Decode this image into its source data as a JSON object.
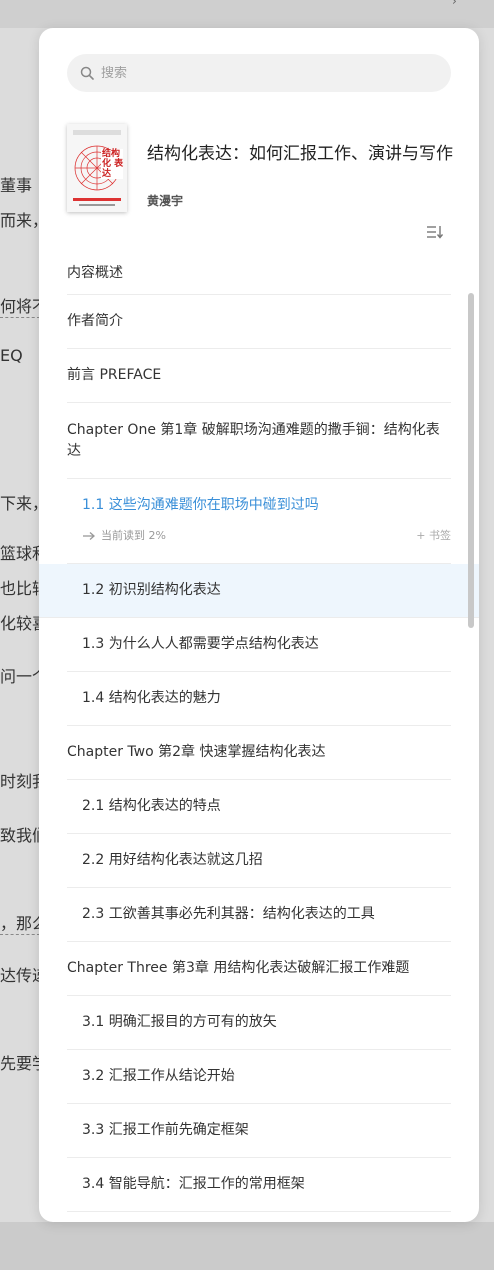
{
  "search": {
    "placeholder": "搜索"
  },
  "book": {
    "title": "结构化表达：如何汇报工作、演讲与写作",
    "author": "黄漫宇",
    "cover_title": "结构化 表达"
  },
  "toc": [
    {
      "label": "内容概述",
      "level": 0
    },
    {
      "label": "作者简介",
      "level": 0
    },
    {
      "label": "前言 PREFACE",
      "level": 0
    },
    {
      "label": "Chapter One 第1章 破解职场沟通难题的撒手锏：结构化表达",
      "level": 0
    },
    {
      "label": "1.1 这些沟通难题你在职场中碰到过吗",
      "level": 1,
      "current": true,
      "progress": "当前读到 2%",
      "bookmark": "+ 书签"
    },
    {
      "label": "1.2 初识别结构化表达",
      "level": 1,
      "highlight": true
    },
    {
      "label": "1.3 为什么人人都需要学点结构化表达",
      "level": 1
    },
    {
      "label": "1.4 结构化表达的魅力",
      "level": 1
    },
    {
      "label": "Chapter Two 第2章 快速掌握结构化表达",
      "level": 0
    },
    {
      "label": "2.1 结构化表达的特点",
      "level": 1
    },
    {
      "label": "2.2 用好结构化表达就这几招",
      "level": 1
    },
    {
      "label": "2.3 工欲善其事必先利其器：结构化表达的工具",
      "level": 1
    },
    {
      "label": "Chapter Three 第3章 用结构化表达破解汇报工作难题",
      "level": 0
    },
    {
      "label": "3.1 明确汇报目的方可有的放矢",
      "level": 1
    },
    {
      "label": "3.2 汇报工作从结论开始",
      "level": 1
    },
    {
      "label": "3.3 汇报工作前先确定框架",
      "level": 1
    },
    {
      "label": "3.4 智能导航：汇报工作的常用框架",
      "level": 1
    }
  ],
  "background_text": [
    "董事",
    "而来，",
    "何将不",
    "EQ",
    "下来，",
    "篮球和",
    "也比较",
    "化较喜",
    "问一个",
    "时刻我",
    "致我们",
    "，那么",
    "达传递",
    "先要学"
  ],
  "colors": {
    "accent": "#3a8fd8",
    "highlight_bg": "#eef6fd"
  }
}
